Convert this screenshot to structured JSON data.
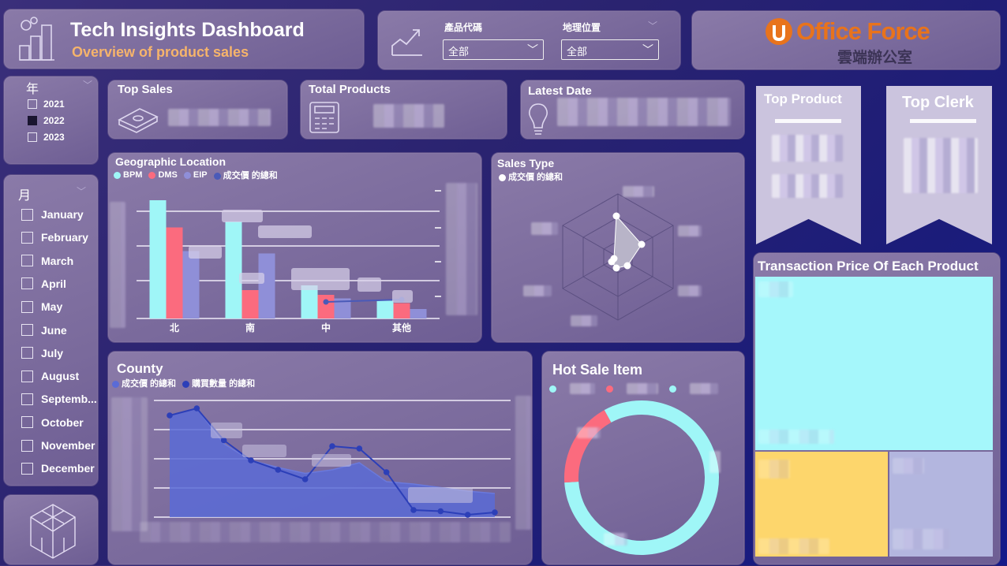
{
  "header": {
    "title": "Tech Insights Dashboard",
    "subtitle": "Overview of product sales"
  },
  "filters": {
    "product_code_label": "產品代碼",
    "product_code_value": "全部",
    "location_label": "地理位置",
    "location_value": "全部"
  },
  "logo": {
    "brand": "Office Force",
    "tagline": "雲端辦公室",
    "brand_color": "#e8731c"
  },
  "year_slicer": {
    "label": "年",
    "items": [
      {
        "label": "2021",
        "checked": false
      },
      {
        "label": "2022",
        "checked": true
      },
      {
        "label": "2023",
        "checked": false
      }
    ]
  },
  "month_slicer": {
    "label": "月",
    "items": [
      "January",
      "February",
      "March",
      "April",
      "May",
      "June",
      "July",
      "August",
      "Septemb...",
      "October",
      "November",
      "December"
    ]
  },
  "kpis": {
    "top_sales": "Top Sales",
    "total_products": "Total Products",
    "latest_date": "Latest Date"
  },
  "geo_chart": {
    "title": "Geographic Location",
    "legend": [
      {
        "name": "BPM",
        "color": "#9ff6f7"
      },
      {
        "name": "DMS",
        "color": "#fb6b7e"
      },
      {
        "name": "EIP",
        "color": "#8f8fd8"
      },
      {
        "name": "成交價 的總和",
        "color": "#4a5ab8"
      }
    ],
    "categories": [
      "北",
      "南",
      "中",
      "其他"
    ]
  },
  "sales_type": {
    "title": "Sales Type",
    "legend": "成交價 的總和"
  },
  "top_product": {
    "title": "Top Product"
  },
  "top_clerk": {
    "title": "Top Clerk"
  },
  "treemap": {
    "title": "Transaction Price Of Each Product",
    "colors": [
      "#a5f7fb",
      "#fdd66c",
      "#b3b6df"
    ]
  },
  "county": {
    "title": "County",
    "legend": [
      {
        "name": "成交價 的總和",
        "color": "#5a6bd6"
      },
      {
        "name": "購買數量 的總和",
        "color": "#2c3fb8"
      }
    ]
  },
  "hot_sale": {
    "title": "Hot Sale Item",
    "colors": [
      "#9ff6f7",
      "#fb6b7e",
      "#9ff6f7"
    ]
  },
  "chart_data": [
    {
      "type": "bar",
      "title": "Geographic Location",
      "categories": [
        "北",
        "南",
        "中",
        "其他"
      ],
      "series": [
        {
          "name": "BPM",
          "values": [
            100,
            82,
            28,
            15
          ]
        },
        {
          "name": "DMS",
          "values": [
            77,
            24,
            20,
            13
          ]
        },
        {
          "name": "EIP",
          "values": [
            57,
            55,
            17,
            8
          ]
        },
        {
          "name": "成交價 的總和",
          "values": [
            null,
            null,
            14,
            16
          ]
        }
      ]
    },
    {
      "type": "area",
      "title": "County",
      "series": [
        {
          "name": "成交價 的總和",
          "values": [
            86,
            92,
            62,
            48,
            42,
            37,
            40,
            46,
            30,
            28,
            25,
            22,
            20
          ]
        },
        {
          "name": "購買數量 的總和",
          "values": [
            86,
            92,
            65,
            48,
            40,
            32,
            60,
            58,
            38,
            6,
            5,
            2,
            4
          ]
        }
      ]
    },
    {
      "type": "pie",
      "title": "Hot Sale Item",
      "values": [
        74,
        18,
        8
      ]
    }
  ]
}
